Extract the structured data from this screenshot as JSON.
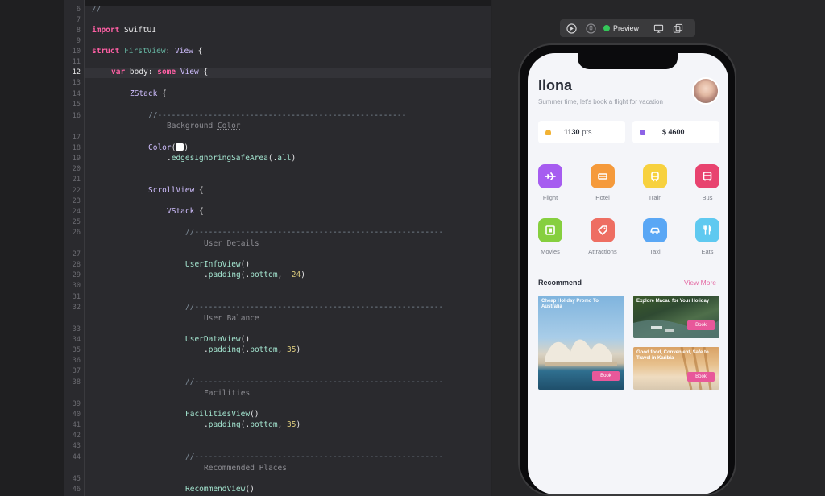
{
  "editor": {
    "lines": [
      {
        "n": "6",
        "code": "//"
      },
      {
        "n": "7",
        "code": ""
      },
      {
        "n": "8",
        "code": "import SwiftUI"
      },
      {
        "n": "9",
        "code": ""
      },
      {
        "n": "10",
        "code": "struct FirstView: View {"
      },
      {
        "n": "11",
        "code": ""
      },
      {
        "n": "12",
        "code": "var body: some View {"
      },
      {
        "n": "13",
        "code": ""
      },
      {
        "n": "14",
        "code": "ZStack {"
      },
      {
        "n": "15",
        "code": ""
      },
      {
        "n": "16",
        "code": "//------------------------------------------------------"
      },
      {
        "n": "17",
        "code": "Background Color"
      },
      {
        "n": "18",
        "code": "Color( )"
      },
      {
        "n": "19",
        "code": ".edgesIgnoringSafeArea(.all)"
      },
      {
        "n": "20",
        "code": ""
      },
      {
        "n": "21",
        "code": ""
      },
      {
        "n": "22",
        "code": "ScrollView {"
      },
      {
        "n": "23",
        "code": ""
      },
      {
        "n": "24",
        "code": "VStack {"
      },
      {
        "n": "25",
        "code": ""
      },
      {
        "n": "26",
        "code": "//------------------------------------------------------"
      },
      {
        "n": "27",
        "code": "User Details"
      },
      {
        "n": "28",
        "code": "UserInfoView()"
      },
      {
        "n": "29",
        "code": ".padding(.bottom,  24)"
      },
      {
        "n": "30",
        "code": ""
      },
      {
        "n": "31",
        "code": ""
      },
      {
        "n": "32",
        "code": "//------------------------------------------------------"
      },
      {
        "n": "33",
        "code": "User Balance"
      },
      {
        "n": "34",
        "code": "UserDataView()"
      },
      {
        "n": "35",
        "code": ".padding(.bottom, 35)"
      },
      {
        "n": "36",
        "code": ""
      },
      {
        "n": "37",
        "code": ""
      },
      {
        "n": "38",
        "code": "//------------------------------------------------------"
      },
      {
        "n": "39",
        "code": "Facilities"
      },
      {
        "n": "40",
        "code": "FacilitiesView()"
      },
      {
        "n": "41",
        "code": ".padding(.bottom, 35)"
      },
      {
        "n": "42",
        "code": ""
      },
      {
        "n": "43",
        "code": ""
      },
      {
        "n": "44",
        "code": "//------------------------------------------------------"
      },
      {
        "n": "45",
        "code": "Recommended Places"
      },
      {
        "n": "46",
        "code": "RecommendView()"
      }
    ],
    "current_line": "12"
  },
  "toolbar": {
    "play_icon": "play-circle-icon",
    "pin_icon": "pin-circle-icon",
    "preview_label": "Preview",
    "device_icon": "device-icon",
    "duplicate_icon": "duplicate-icon"
  },
  "app": {
    "user_name": "Ilona",
    "subtitle": "Summer time, let's book a flight for vacation",
    "balance": {
      "points_value": "1130",
      "points_unit": "pts",
      "money": "$ 4600"
    },
    "facilities": [
      {
        "label": "Flight",
        "icon": "airplane-icon",
        "color": "#a65cf0"
      },
      {
        "label": "Hotel",
        "icon": "bed-icon",
        "color": "#f59a3b"
      },
      {
        "label": "Train",
        "icon": "train-icon",
        "color": "#f7d13f"
      },
      {
        "label": "Bus",
        "icon": "bus-icon",
        "color": "#e8436f"
      },
      {
        "label": "Movies",
        "icon": "film-icon",
        "color": "#86cf3f"
      },
      {
        "label": "Attractions",
        "icon": "tag-icon",
        "color": "#ee6e62"
      },
      {
        "label": "Taxi",
        "icon": "car-icon",
        "color": "#5aa7f5"
      },
      {
        "label": "Eats",
        "icon": "fork-knife-icon",
        "color": "#5fc9f0"
      }
    ],
    "recommend_title": "Recommend",
    "view_more": "View More",
    "places": [
      {
        "title": "Cheap Holiday Promo To Australia",
        "button": "Book"
      },
      {
        "title": "Explore Macau for Your Holiday",
        "button": "Book"
      },
      {
        "title": "Good food, Convenient, Safe to Travel in Karibia",
        "button": "Book"
      }
    ]
  },
  "colors": {
    "accent_pink": "#e8589a",
    "editor_bg": "#2a2a2e",
    "screen_bg": "#f4f5f9"
  }
}
